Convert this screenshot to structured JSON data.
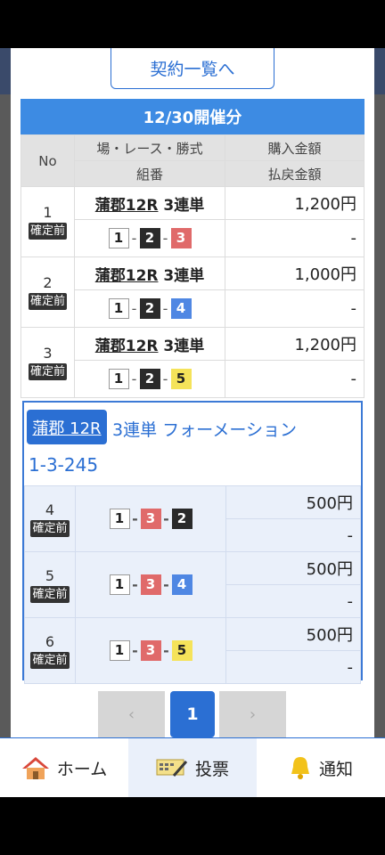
{
  "contract_list_label": "契約一覧へ",
  "date_header": "12/30開催分",
  "table_headers": {
    "no": "No",
    "venue_race_type": "場・レース・勝式",
    "combination": "組番",
    "purchase_amount": "購入金額",
    "payout_amount": "払戻金額"
  },
  "bets": [
    {
      "no": "1",
      "status": "確定前",
      "venue_race": "蒲郡12R",
      "bet_type": "3連単",
      "amount": "1,200円",
      "payout": "-",
      "combo": [
        "1",
        "2",
        "3"
      ]
    },
    {
      "no": "2",
      "status": "確定前",
      "venue_race": "蒲郡12R",
      "bet_type": "3連単",
      "amount": "1,000円",
      "payout": "-",
      "combo": [
        "1",
        "2",
        "4"
      ]
    },
    {
      "no": "3",
      "status": "確定前",
      "venue_race": "蒲郡12R",
      "bet_type": "3連単",
      "amount": "1,200円",
      "payout": "-",
      "combo": [
        "1",
        "2",
        "5"
      ]
    }
  ],
  "formation": {
    "venue": "蒲郡 12R",
    "type": "3連単 フォーメーション",
    "combination": "1-3-245",
    "rows": [
      {
        "no": "4",
        "status": "確定前",
        "amount": "500円",
        "payout": "-",
        "combo": [
          "1",
          "3",
          "2"
        ]
      },
      {
        "no": "5",
        "status": "確定前",
        "amount": "500円",
        "payout": "-",
        "combo": [
          "1",
          "3",
          "4"
        ]
      },
      {
        "no": "6",
        "status": "確定前",
        "amount": "500円",
        "payout": "-",
        "combo": [
          "1",
          "3",
          "5"
        ]
      }
    ]
  },
  "pager": {
    "prev": "‹",
    "current": "1",
    "next": "›"
  },
  "tabs": {
    "home": "ホーム",
    "vote": "投票",
    "notify": "通知"
  },
  "colors": {
    "accent": "#2b6fd3",
    "header_blue": "#3d8be3",
    "n1": "#ffffff",
    "n2": "#2a2a2a",
    "n3": "#e06a6a",
    "n4": "#4f87e3",
    "n5": "#f5e35a"
  }
}
